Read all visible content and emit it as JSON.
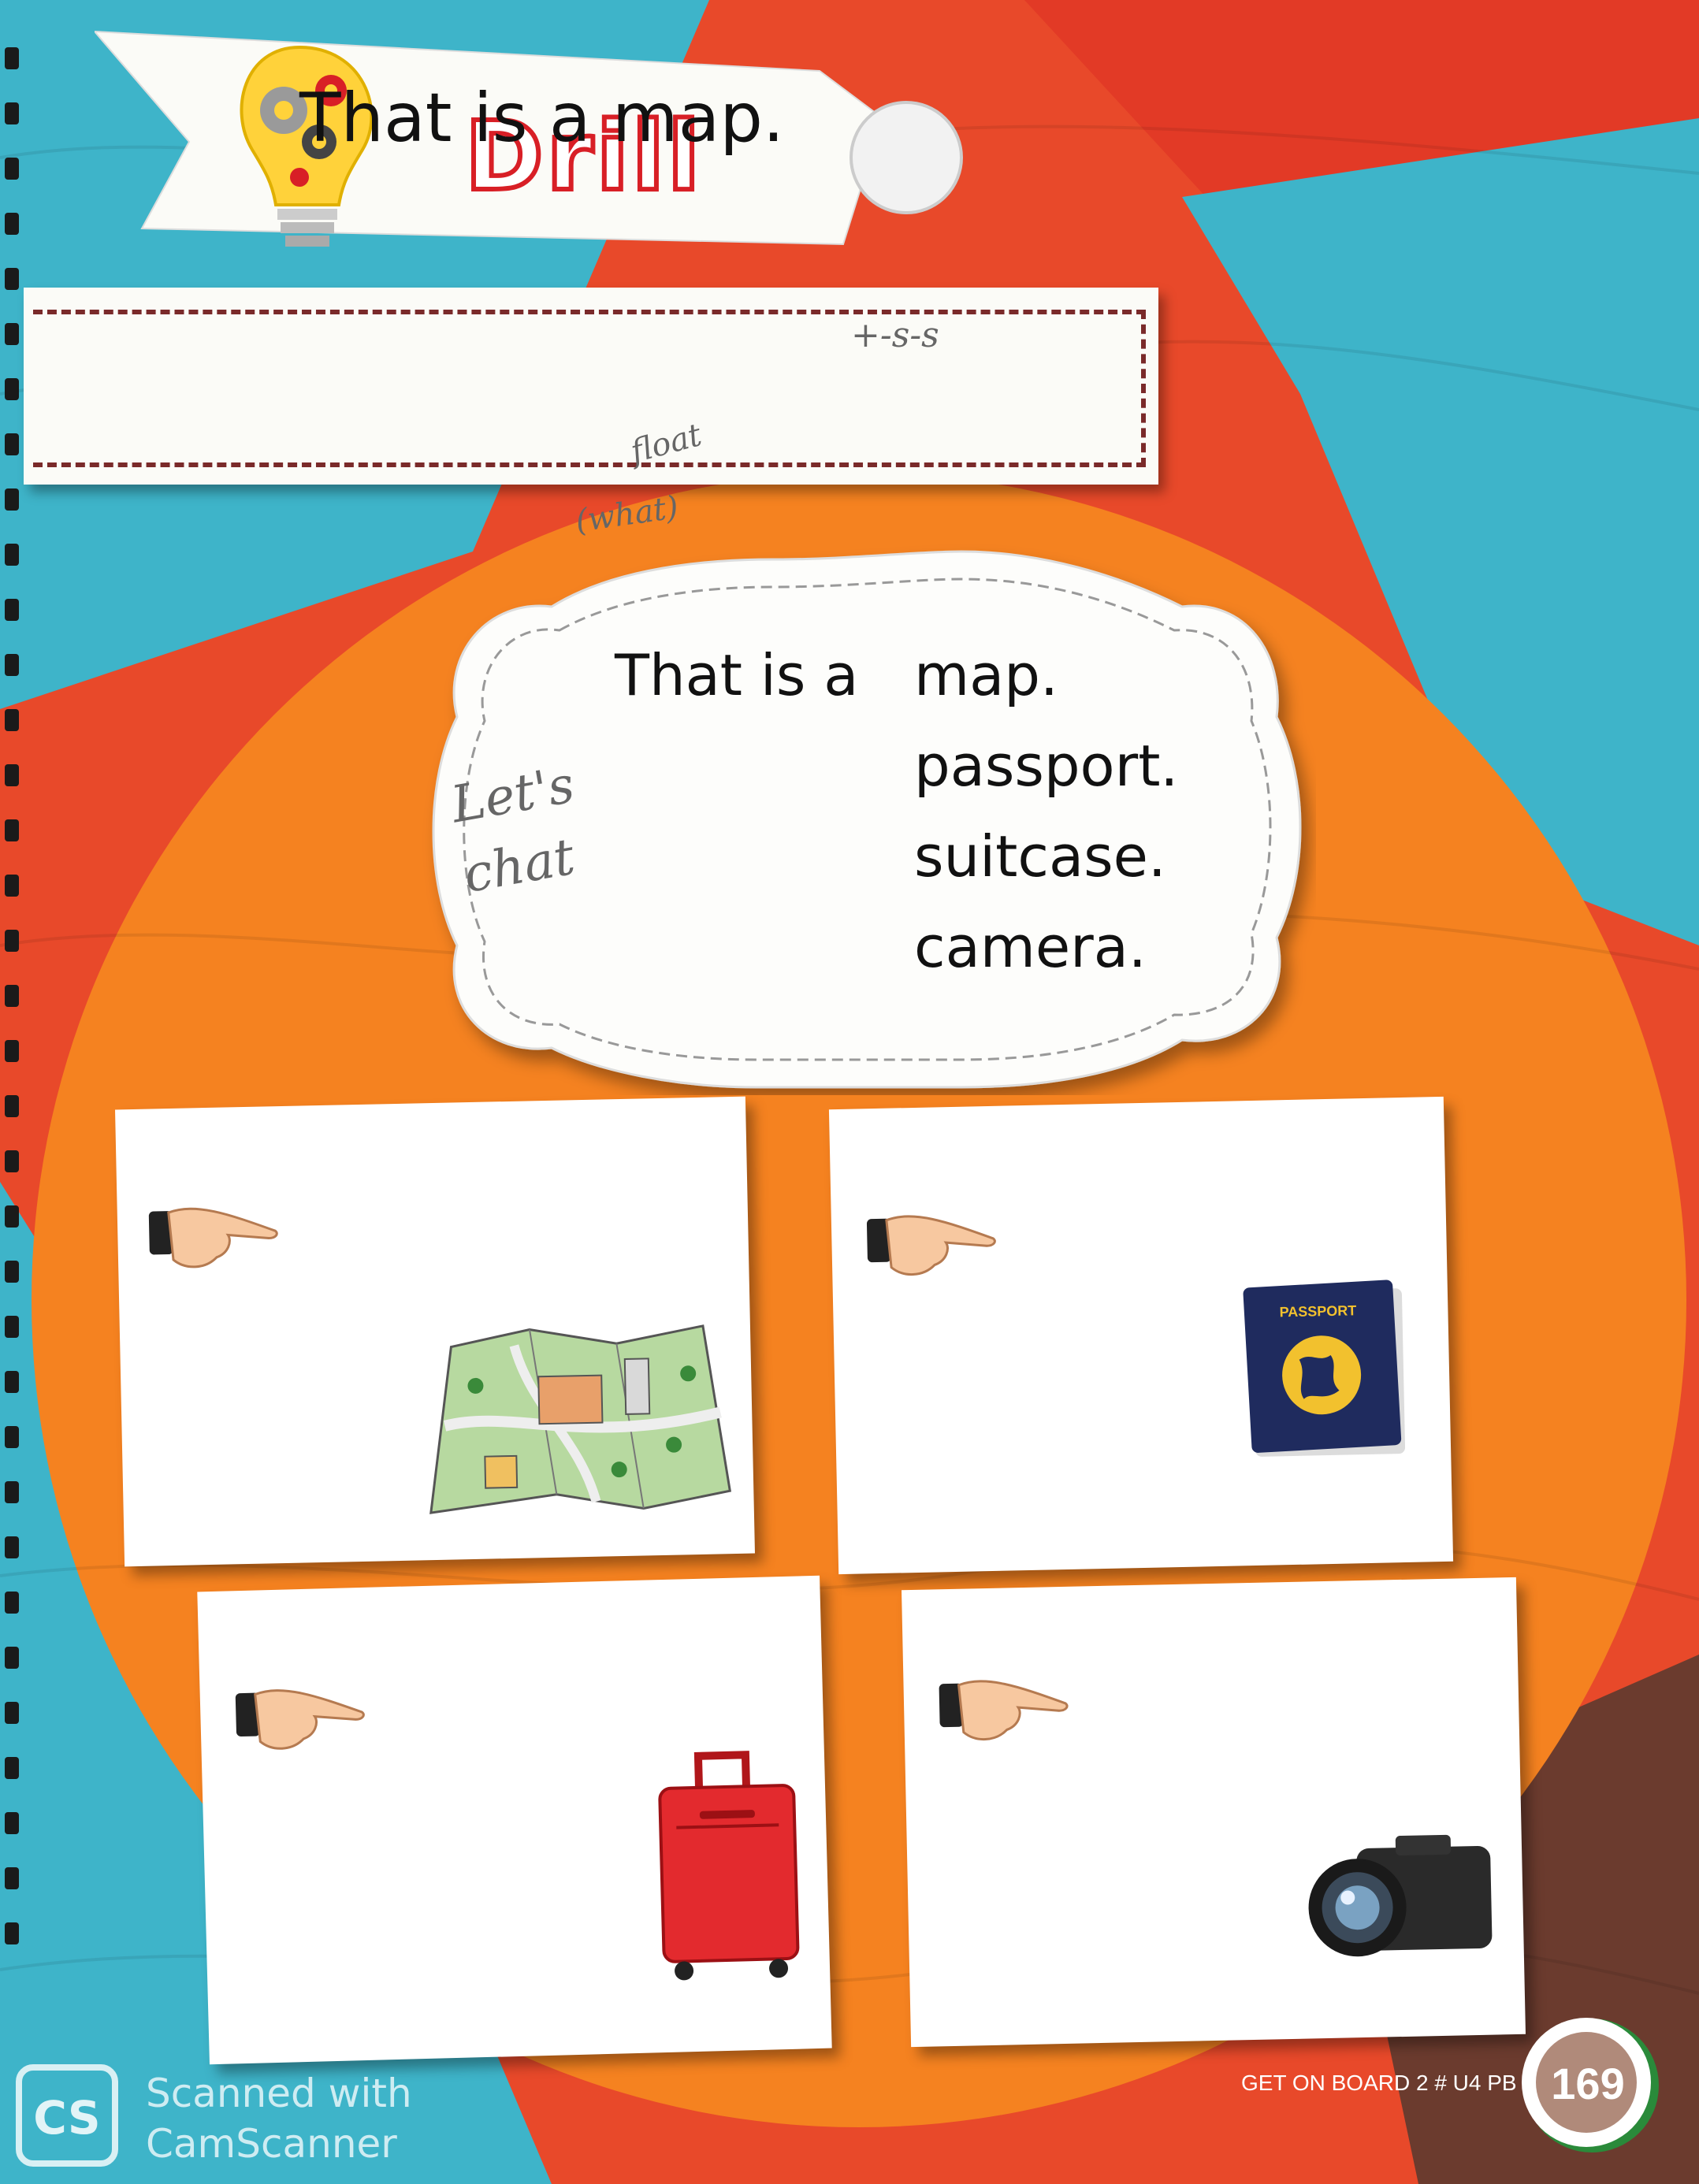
{
  "drill": {
    "title": "Drill"
  },
  "sentence_strip": {
    "text": "That is a map."
  },
  "chat_box": {
    "lead": "That is a",
    "options": [
      "map.",
      "passport.",
      "suitcase.",
      "camera."
    ]
  },
  "handwriting": {
    "top": "+-s-s",
    "note_a": "float",
    "note_b": "(what)",
    "side": "Let's chat"
  },
  "cards": [
    {
      "item": "map",
      "icon": "map-icon"
    },
    {
      "item": "passport",
      "icon": "passport-icon",
      "cover_text": "PASSPORT"
    },
    {
      "item": "suitcase",
      "icon": "suitcase-icon"
    },
    {
      "item": "camera",
      "icon": "camera-icon"
    }
  ],
  "footer": {
    "book": "GET ON BOARD 2 # U4 PB",
    "page": "169"
  },
  "watermark": {
    "logo": "CS",
    "line1": "Scanned with",
    "line2": "CamScanner"
  },
  "colors": {
    "orange": "#f58220",
    "red": "#e63a23",
    "teal": "#3bb3c8",
    "title_red": "#d81f26"
  }
}
